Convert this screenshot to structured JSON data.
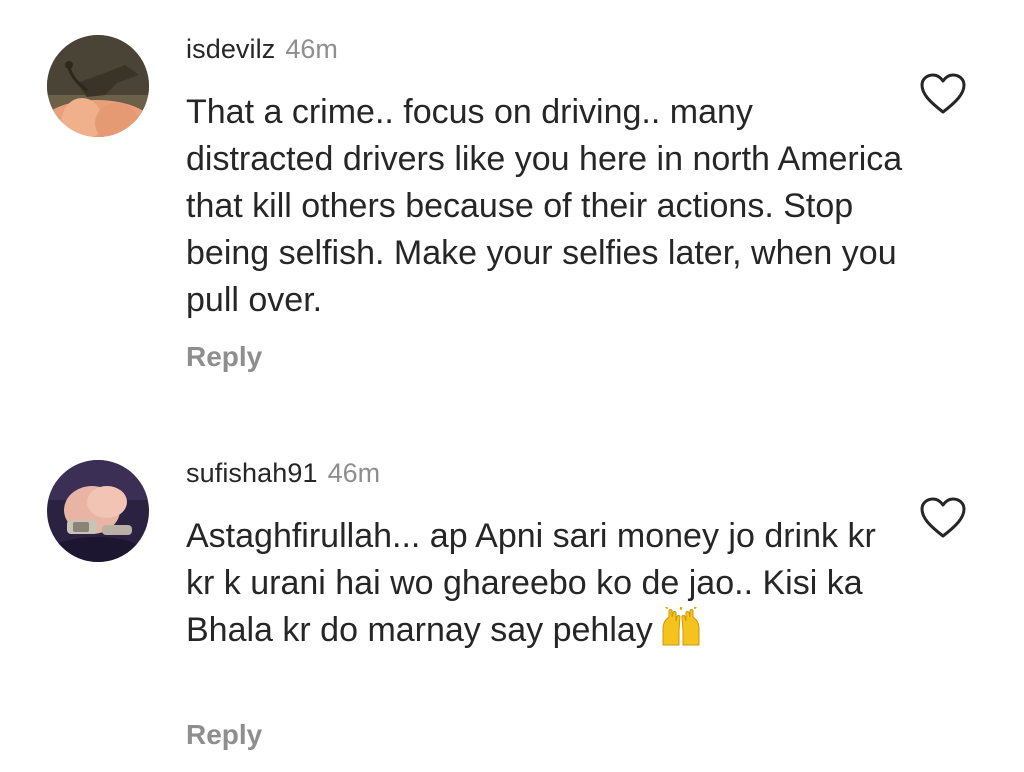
{
  "comments": [
    {
      "username": "isdevilz",
      "time": "46m",
      "text": "That a crime.. focus on driving.. many distracted drivers like you here in north America that kill others because of their actions. Stop being selfish. Make your selfies later, when you pull over.",
      "reply_label": "Reply",
      "avatar_icon": "avatar-hand-dragon",
      "like_icon": "heart-outline-icon"
    },
    {
      "username": "sufishah91",
      "time": "46m",
      "text": "Astaghfirullah... ap Apni sari money jo drink kr kr k urani hai wo ghareebo ko de jao.. Kisi ka Bhala kr do marnay say pehlay",
      "emoji": "🙌",
      "reply_label": "Reply",
      "avatar_icon": "avatar-clasped-hands-watch",
      "like_icon": "heart-outline-icon"
    }
  ],
  "colors": {
    "text": "#262626",
    "secondary": "#8e8e8e",
    "background": "#ffffff"
  }
}
